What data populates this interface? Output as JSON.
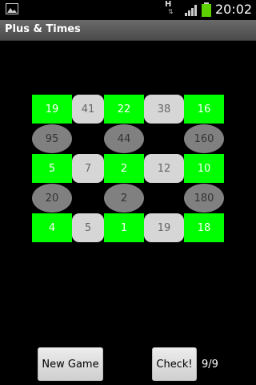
{
  "status_bar": {
    "time": "20:02",
    "network_letter": "H",
    "icons": [
      "image-icon",
      "network-activity-icon",
      "signal-icon",
      "battery-icon"
    ],
    "colors": {
      "battery": "#5ed100"
    }
  },
  "app": {
    "title": "Plus & Times"
  },
  "board": {
    "rows": [
      [
        "19",
        "41",
        "22",
        "38",
        "16"
      ],
      [
        "95",
        "44",
        "160"
      ],
      [
        "5",
        "7",
        "2",
        "12",
        "10"
      ],
      [
        "20",
        "2",
        "180"
      ],
      [
        "4",
        "5",
        "1",
        "19",
        "18"
      ]
    ],
    "colors": {
      "number_cell": "#00ff00",
      "sum_cell": "#d6d6d6",
      "product_cell": "#808080"
    }
  },
  "controls": {
    "new_game_label": "New Game",
    "check_label": "Check!",
    "score": "9/9"
  }
}
